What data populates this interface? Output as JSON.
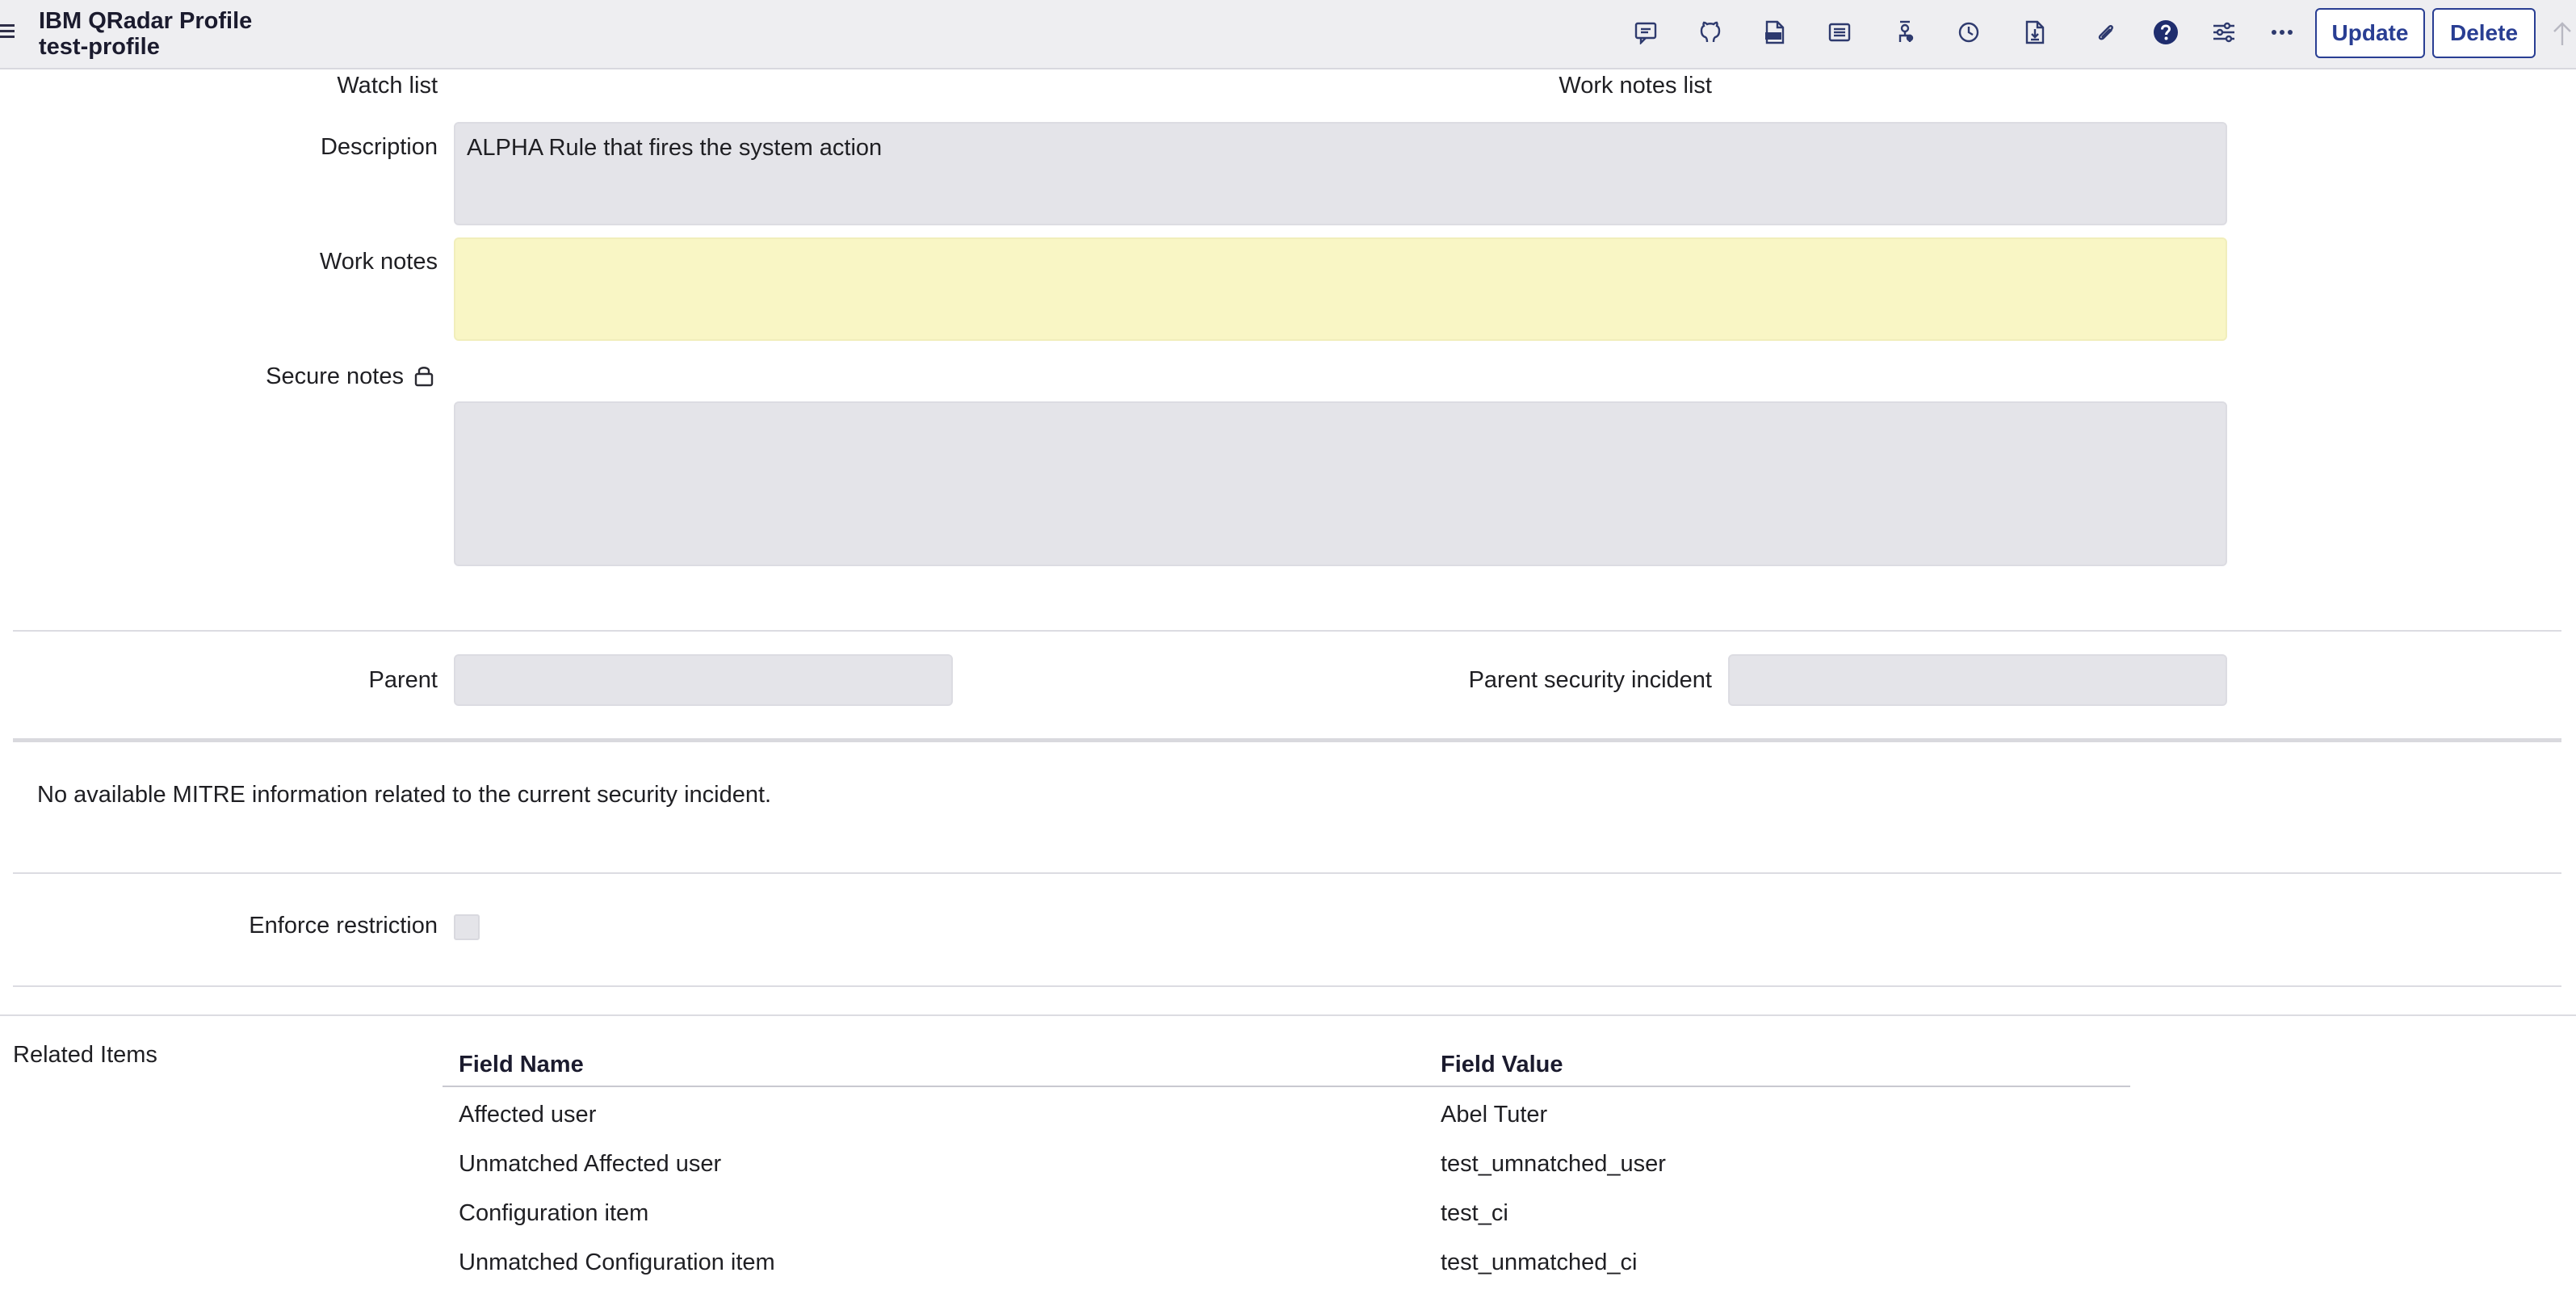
{
  "header": {
    "title": "IBM QRadar Profile",
    "subtitle": "test-profile",
    "toolbar_icons": [
      "comment-icon",
      "github-icon",
      "pdf-icon",
      "list-icon",
      "workflow-icon",
      "history-icon",
      "document-download-icon",
      "paperclip-icon",
      "help-icon",
      "settings-sliders-icon",
      "more-icon"
    ],
    "update_label": "Update",
    "delete_label": "Delete"
  },
  "form": {
    "watch_list_label": "Watch list",
    "work_notes_list_label": "Work notes list",
    "description_label": "Description",
    "description_value": "ALPHA Rule that fires the system action",
    "work_notes_label": "Work notes",
    "work_notes_value": "",
    "secure_notes_label": "Secure notes",
    "secure_notes_value": "",
    "parent_label": "Parent",
    "parent_value": "",
    "parent_security_incident_label": "Parent security incident",
    "parent_security_incident_value": "",
    "mitre_message": "No available MITRE information related to the current security incident.",
    "enforce_restriction_label": "Enforce restriction",
    "enforce_restriction_checked": false
  },
  "related_items": {
    "title": "Related Items",
    "columns": [
      "Field Name",
      "Field Value"
    ],
    "rows": [
      {
        "name": "Affected user",
        "value": "Abel Tuter"
      },
      {
        "name": "Unmatched Affected user",
        "value": "test_umnatched_user"
      },
      {
        "name": "Configuration item",
        "value": "test_ci"
      },
      {
        "name": "Unmatched Configuration item",
        "value": "test_unmatched_ci"
      }
    ]
  },
  "colors": {
    "header_bg": "#eeeef1",
    "accent": "#293e93",
    "field_bg": "#e4e4e9",
    "work_notes_bg": "#f9f6c5"
  }
}
